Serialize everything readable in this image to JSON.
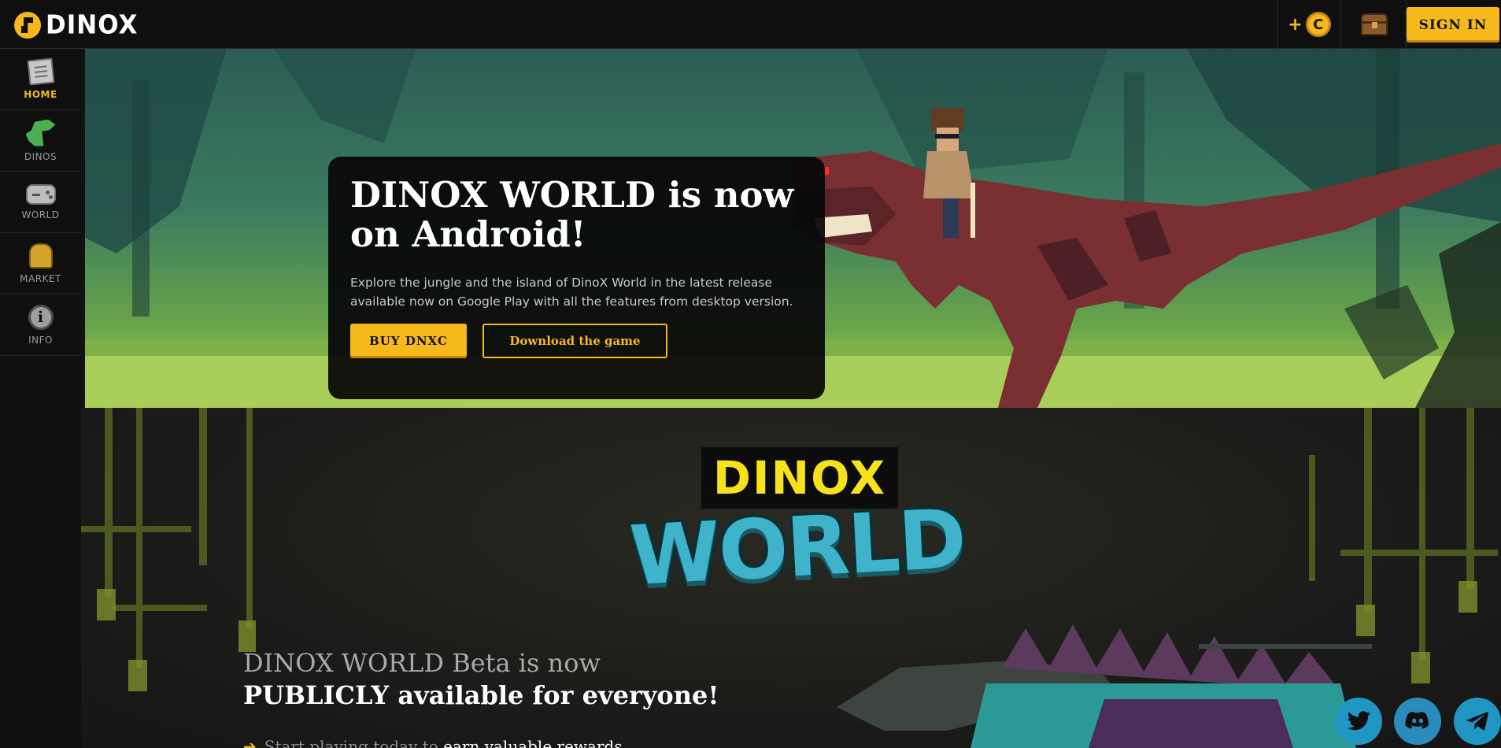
{
  "brand": {
    "name": "DINOX"
  },
  "header": {
    "coin_plus": "+",
    "coin_symbol": "C",
    "signin_label": "SIGN IN"
  },
  "sidebar": {
    "items": [
      {
        "label": "HOME",
        "icon": "home-book-icon",
        "active": true
      },
      {
        "label": "DINOS",
        "icon": "dino-icon",
        "active": false
      },
      {
        "label": "WORLD",
        "icon": "gamepad-icon",
        "active": false
      },
      {
        "label": "MARKET",
        "icon": "market-bag-icon",
        "active": false
      },
      {
        "label": "INFO",
        "icon": "info-icon",
        "active": false
      }
    ]
  },
  "hero": {
    "title": "DINOX WORLD is now on Android!",
    "description": "Explore the jungle and the island of DinoX World in the latest release available now on Google Play with all the features from desktop version.",
    "buy_button": "BUY DNXC",
    "download_button": "Download the game"
  },
  "world_logo": {
    "top": "DINOX",
    "bottom": "WORLD"
  },
  "beta": {
    "line1": "DINOX WORLD Beta is now",
    "line2": "PUBLICLY available for everyone!",
    "start_prefix": "Start playing today to ",
    "start_highlight": "earn valuable rewards"
  },
  "social": [
    {
      "name": "twitter",
      "icon": "twitter-icon"
    },
    {
      "name": "discord",
      "icon": "discord-icon"
    },
    {
      "name": "telegram",
      "icon": "telegram-icon"
    }
  ],
  "colors": {
    "accent": "#f5b91c",
    "background": "#121212",
    "world_teal": "#3fb3c9",
    "dinox_yellow": "#f5e21a",
    "social_blue": "#1f96c4"
  }
}
